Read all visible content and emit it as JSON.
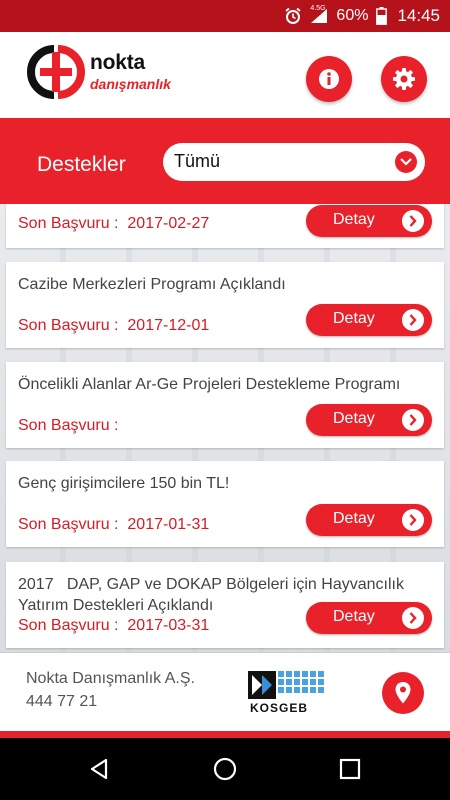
{
  "status_bar": {
    "network": "4.5G",
    "battery": "60%",
    "time": "14:45",
    "icons": [
      "alarm-icon",
      "signal-icon",
      "battery-icon"
    ]
  },
  "header": {
    "logo_name": "nokta",
    "logo_sub": "danışmanlık",
    "info_icon": "info-icon",
    "settings_icon": "gear-icon"
  },
  "filter": {
    "label": "Destekler",
    "selected": "Tümü"
  },
  "items": [
    {
      "title": "",
      "deadline_label": "Son Başvuru :",
      "deadline": "2017-02-27",
      "button": "Detay"
    },
    {
      "title": "Cazibe Merkezleri Programı Açıklandı",
      "deadline_label": "Son Başvuru :",
      "deadline": "2017-12-01",
      "button": "Detay"
    },
    {
      "title": "Öncelikli Alanlar Ar-Ge Projeleri Destekleme Programı",
      "deadline_label": "Son Başvuru :",
      "deadline": "",
      "button": "Detay"
    },
    {
      "title": "Genç girişimcilere 150 bin TL!",
      "deadline_label": "Son Başvuru :",
      "deadline": "2017-01-31",
      "button": "Detay"
    },
    {
      "title": "2017   DAP, GAP ve DOKAP Bölgeleri için Hayvancılık Yatırım Destekleri Açıklandı",
      "deadline_label": "Son Başvuru :",
      "deadline": "2017-03-31",
      "button": "Detay"
    }
  ],
  "footer": {
    "company": "Nokta Danışmanlık A.Ş.",
    "phone": "444 77 21",
    "partner_logo": "KOSGEB",
    "location_icon": "location-pin-icon"
  },
  "colors": {
    "brand_red": "#e8212a",
    "status_bar": "#b5121b",
    "deadline_text": "#d81b23"
  }
}
